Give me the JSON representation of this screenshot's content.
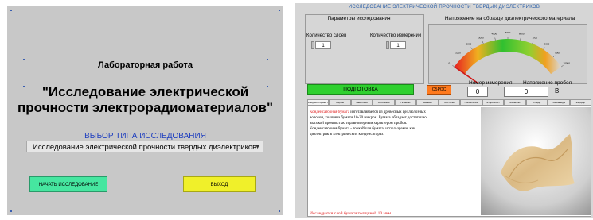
{
  "left": {
    "lab_title": "Лабораторная работа",
    "title_line1": "\"Исследование электрической",
    "title_line2": "прочности электрорадиоматериалов\"",
    "choose_label": "ВЫБОР ТИПА ИССЛЕДОВАНИЯ",
    "select_value": "Исследование электрической прочности твердых диэлектриков",
    "start_button": "НАЧАТЬ ИССЛЕДОВАНИЕ",
    "exit_button": "ВЫХОД",
    "colors": {
      "panel": "#c8c8c8",
      "start": "#46e6a0",
      "exit": "#f0f02a",
      "accent_text": "#1f3fbf"
    }
  },
  "right": {
    "title": "ИССЛЕДОВАНИЕ ЭЛЕКТРИЧЕСКОЙ ПРОЧНОСТИ ТВЕРДЫХ ДИЭЛЕКТРИКОВ",
    "params_label": "Параметры исследования",
    "layers_label": "Количество слоев",
    "layers_value": "1",
    "measurements_label": "Количество измерений",
    "measurements_value": "1",
    "voltage_label": "Напряжение на образце диэлектрического материала",
    "gauge_ticks": [
      "0",
      "1000",
      "2000",
      "3000",
      "4000",
      "5000",
      "6000",
      "7000",
      "8000",
      "9000",
      "10000"
    ],
    "gauge_value": 0,
    "prep_button": "ПОДГОТОВКА",
    "reset_button": "СБРОС",
    "measure_no_label": "Номер измерения",
    "measure_no_value": "0",
    "breakdown_label": "Напряжение пробоя",
    "breakdown_value": "0",
    "breakdown_unit": "В",
    "tabs": [
      "Конденсаторная бумага",
      "Картон",
      "Лакоткань",
      "Асботкани",
      "Гетинакс",
      "Миканит",
      "Текстолит",
      "Полиэтилен",
      "Фторопласт",
      "Микалекс",
      "Слюда",
      "Полиамиды",
      "Фарфор"
    ],
    "active_tab": 0,
    "para_highlight": "Конденсаторная бумага",
    "para_text": " изготавливается из древесных целлюлозных волокон, толщина бумаги 10-20 микрон. Бумага обладает достаточно высокой прочностью и равномерным характером пробоя.",
    "para_text2": "Конденсаторная бумага - тонкайшая бумага, используемая как диэлектрик в электрических конденсаторах.",
    "footer_text": "Исследуется слой бумаги толщиной 10 мкм",
    "colors": {
      "panel": "#d6d6d6",
      "prep": "#2fd02f",
      "reset": "#ff7a1e",
      "title": "#2a5fa8",
      "highlight": "#e01a1a"
    }
  }
}
